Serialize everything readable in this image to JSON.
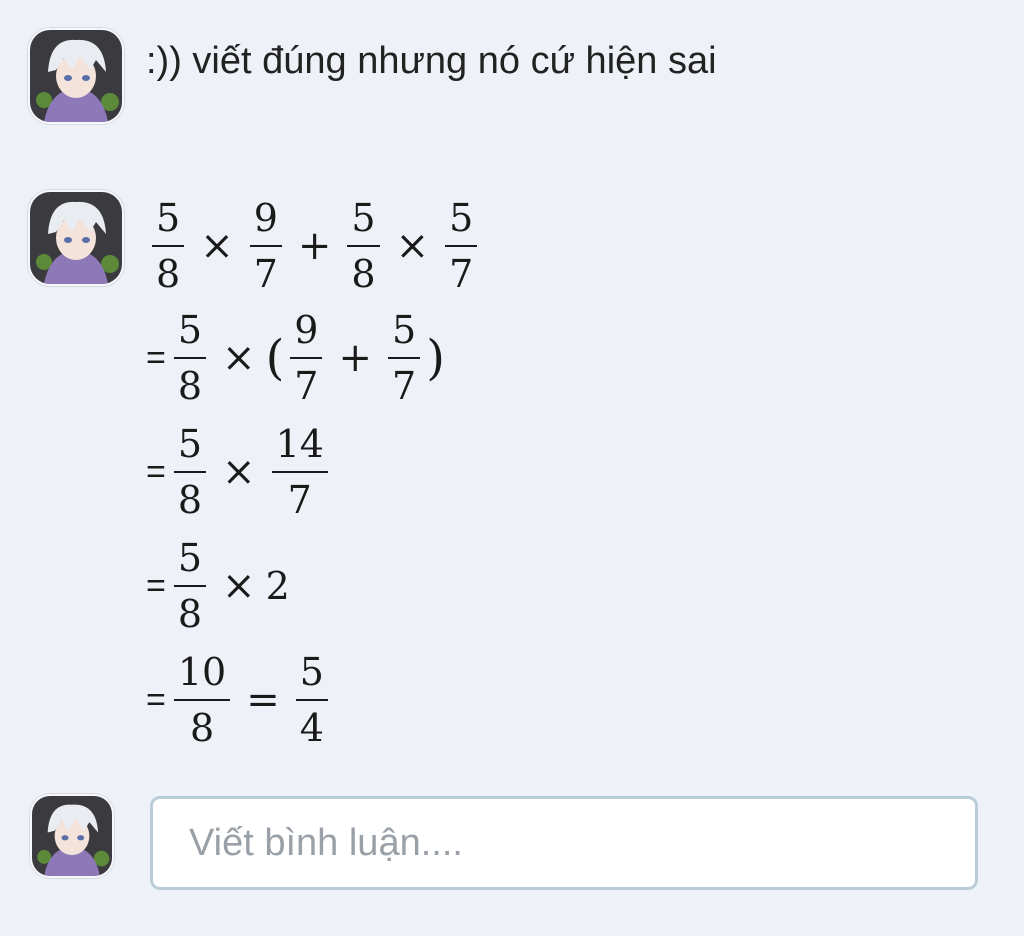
{
  "comment": {
    "text": ":)) viết đúng nhưng nó cứ hiện sai"
  },
  "solution": {
    "line1": {
      "a_n": "5",
      "a_d": "8",
      "op1": "×",
      "b_n": "9",
      "b_d": "7",
      "op2": "+",
      "c_n": "5",
      "c_d": "8",
      "op3": "×",
      "d_n": "5",
      "d_d": "7"
    },
    "line2": {
      "eq": "=",
      "a_n": "5",
      "a_d": "8",
      "op1": "×",
      "lparen": "(",
      "b_n": "9",
      "b_d": "7",
      "op2": "+",
      "c_n": "5",
      "c_d": "7",
      "rparen": ")"
    },
    "line3": {
      "eq": "=",
      "a_n": "5",
      "a_d": "8",
      "op1": "×",
      "b_n": "14",
      "b_d": "7"
    },
    "line4": {
      "eq": "=",
      "a_n": "5",
      "a_d": "8",
      "op1": "×",
      "num": "2"
    },
    "line5": {
      "eq": "=",
      "a_n": "10",
      "a_d": "8",
      "op1": "=",
      "b_n": "5",
      "b_d": "4"
    }
  },
  "reply_box": {
    "placeholder": "Viết bình luận...."
  },
  "icons": {
    "avatar": "user-avatar-icon"
  }
}
